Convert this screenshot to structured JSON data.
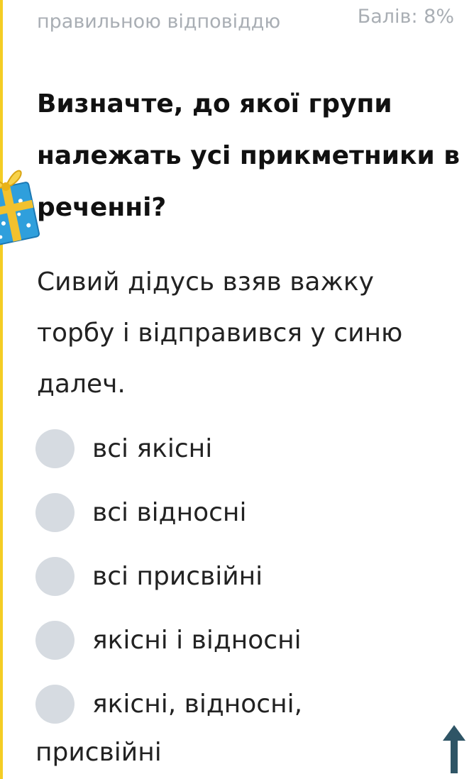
{
  "header": {
    "hint_text": "правильною відповіддю",
    "score_label": "Балів: 8%"
  },
  "question": {
    "title": "Визначте, до якої групи належать усі прикметники в реченні?",
    "sentence": "Сивий дідусь взяв важку торбу і відправився у синю далеч."
  },
  "options": [
    {
      "label": "всі якісні"
    },
    {
      "label": "всі відносні"
    },
    {
      "label": "всі присвійні"
    },
    {
      "label": "якісні і відносні"
    },
    {
      "label_line1": "якісні, відносні,",
      "label_line2": "присвійні"
    }
  ],
  "icons": {
    "gift": "gift-icon",
    "scroll_top": "arrow-up-icon"
  },
  "colors": {
    "accent_stripe": "#f4cd25",
    "radio_fill": "#d6dbe1",
    "muted_text": "#a9aeb4",
    "arrow": "#2f5566"
  }
}
